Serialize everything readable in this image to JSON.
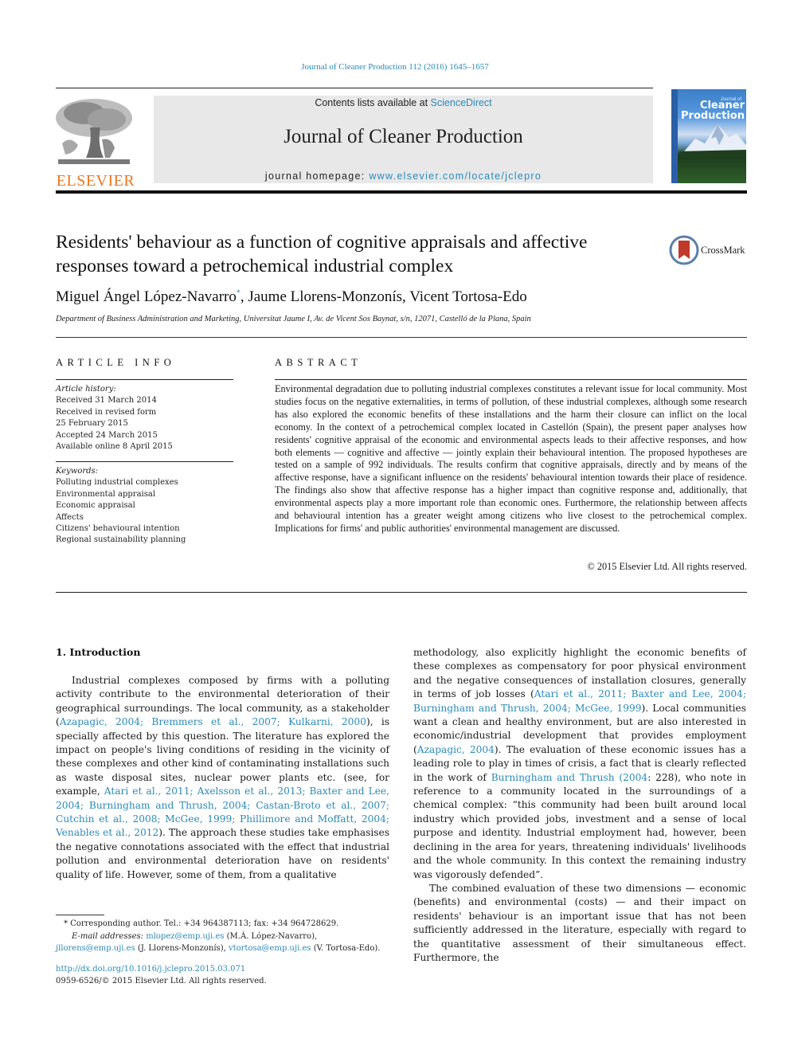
{
  "header": {
    "citation": "Journal of Cleaner Production 112 (2016) 1645–1657",
    "publisher_logo_text": "ELSEVIER",
    "contents_prefix": "Contents lists available at ",
    "contents_link": "ScienceDirect",
    "journal_name": "Journal of Cleaner Production",
    "homepage_prefix": "journal homepage: ",
    "homepage_link": "www.elsevier.com/locate/jclepro",
    "cover": {
      "small_text": "Journal of",
      "title_line1": "Cleaner",
      "title_line2": "Production"
    }
  },
  "article": {
    "title": "Residents' behaviour as a function of cognitive appraisals and affective responses toward a petrochemical industrial complex",
    "crossmark_label": "CrossMark",
    "authors": [
      {
        "name": "Miguel Ángel López-Navarro",
        "mark": "*"
      },
      {
        "name": "Jaume Llorens-Monzonís",
        "mark": ""
      },
      {
        "name": "Vicent Tortosa-Edo",
        "mark": ""
      }
    ],
    "affiliation": "Department of Business Administration and Marketing, Universitat Jaume I, Av. de Vicent Sos Baynat, s/n, 12071, Castelló de la Plana, Spain"
  },
  "article_info": {
    "heading": "ARTICLE INFO",
    "history_label": "Article history:",
    "history": [
      "Received 31 March 2014",
      "Received in revised form",
      "25 February 2015",
      "Accepted 24 March 2015",
      "Available online 8 April 2015"
    ],
    "keywords_label": "Keywords:",
    "keywords": [
      "Polluting industrial complexes",
      "Environmental appraisal",
      "Economic appraisal",
      "Affects",
      "Citizens' behavioural intention",
      "Regional sustainability planning"
    ]
  },
  "abstract": {
    "heading": "ABSTRACT",
    "text": "Environmental degradation due to polluting industrial complexes constitutes a relevant issue for local community. Most studies focus on the negative externalities, in terms of pollution, of these industrial complexes, although some research has also explored the economic benefits of these installations and the harm their closure can inflict on the local economy. In the context of a petrochemical complex located in Castellón (Spain), the present paper analyses how residents' cognitive appraisal of the economic and environmental aspects leads to their affective responses, and how both elements — cognitive and affective — jointly explain their behavioural intention. The proposed hypotheses are tested on a sample of 992 individuals. The results confirm that cognitive appraisals, directly and by means of the affective response, have a significant influence on the residents' behavioural intention towards their place of residence. The findings also show that affective response has a higher impact than cognitive response and, additionally, that environmental aspects play a more important role than economic ones. Furthermore, the relationship between affects and behavioural intention has a greater weight among citizens who live closest to the petrochemical complex. Implications for firms' and public authorities' environmental management are discussed.",
    "copyright": "© 2015 Elsevier Ltd. All rights reserved."
  },
  "body": {
    "section_heading": "1.  Introduction",
    "left_column": {
      "p1_a": "Industrial complexes composed by firms with a polluting activity contribute to the environmental deterioration of their geographical surroundings. The local community, as a stakeholder (",
      "p1_cite1": "Azapagic, 2004; Bremmers et al., 2007; Kulkarni, 2000",
      "p1_b": "), is specially affected by this question. The literature has explored the impact on people's living conditions of residing in the vicinity of these complexes and other kind of contaminating installations such as waste disposal sites, nuclear power plants etc. (see, for example, ",
      "p1_cite2": "Atari et al., 2011; Axelsson et al., 2013; Baxter and Lee, 2004; Burningham and Thrush, 2004; Castan-Broto et al., 2007; Cutchin et al., 2008; McGee, 1999; Phillimore and Moffatt, 2004; Venables et al., 2012",
      "p1_c": "). The approach these studies take emphasises the negative connotations associated with the effect that industrial pollution and environmental deterioration have on residents' quality of life. However, some of them, from a qualitative"
    },
    "right_column": {
      "p1_a": "methodology, also explicitly highlight the economic benefits of these complexes as compensatory for poor physical environment and the negative consequences of installation closures, generally in terms of job losses (",
      "p1_cite1": "Atari et al., 2011; Baxter and Lee, 2004; Burningham and Thrush, 2004; McGee, 1999",
      "p1_b": "). Local communities want a clean and healthy environment, but are also interested in economic/industrial development that provides employment (",
      "p1_cite2": "Azapagic, 2004",
      "p1_c": "). The evaluation of these economic issues has a leading role to play in times of crisis, a fact that is clearly reflected in the work of ",
      "p1_cite3": "Burningham and Thrush (2004",
      "p1_d": ": 228), who note in reference to a community located in the surroundings of a chemical complex: “this community had been built around local industry which provided jobs, investment and a sense of local purpose and identity. Industrial employment had, however, been declining in the area for years, threatening individuals' livelihoods and the whole community. In this context the remaining industry was vigorously defended”.",
      "p2": "The combined evaluation of these two dimensions — economic (benefits) and environmental (costs) — and their impact on residents' behaviour is an important issue that has not been sufficiently addressed in the literature, especially with regard to the quantitative assessment of their simultaneous effect. Furthermore, the"
    }
  },
  "footnote": {
    "corresponding": "* Corresponding author. Tel.: +34 964387113; fax: +34 964728629.",
    "email_label": "E-mail addresses:",
    "emails": [
      {
        "address": "mlopez@emp.uji.es",
        "owner": " (M.Á. López-Navarro), "
      },
      {
        "address": "jllorens@emp.uji.es",
        "owner": " (J. Llorens-Monzonís), "
      },
      {
        "address": "vtortosa@emp.uji.es",
        "owner": " (V. Tortosa-Edo)."
      }
    ],
    "doi": "http://dx.doi.org/10.1016/j.jclepro.2015.03.071",
    "issn": "0959-6526/© 2015 Elsevier Ltd. All rights reserved."
  },
  "colors": {
    "link": "#2a8ab8",
    "elsevier_orange": "#e87722",
    "header_box": "#e8e8e8",
    "crossmark_red": "#c0392b"
  }
}
